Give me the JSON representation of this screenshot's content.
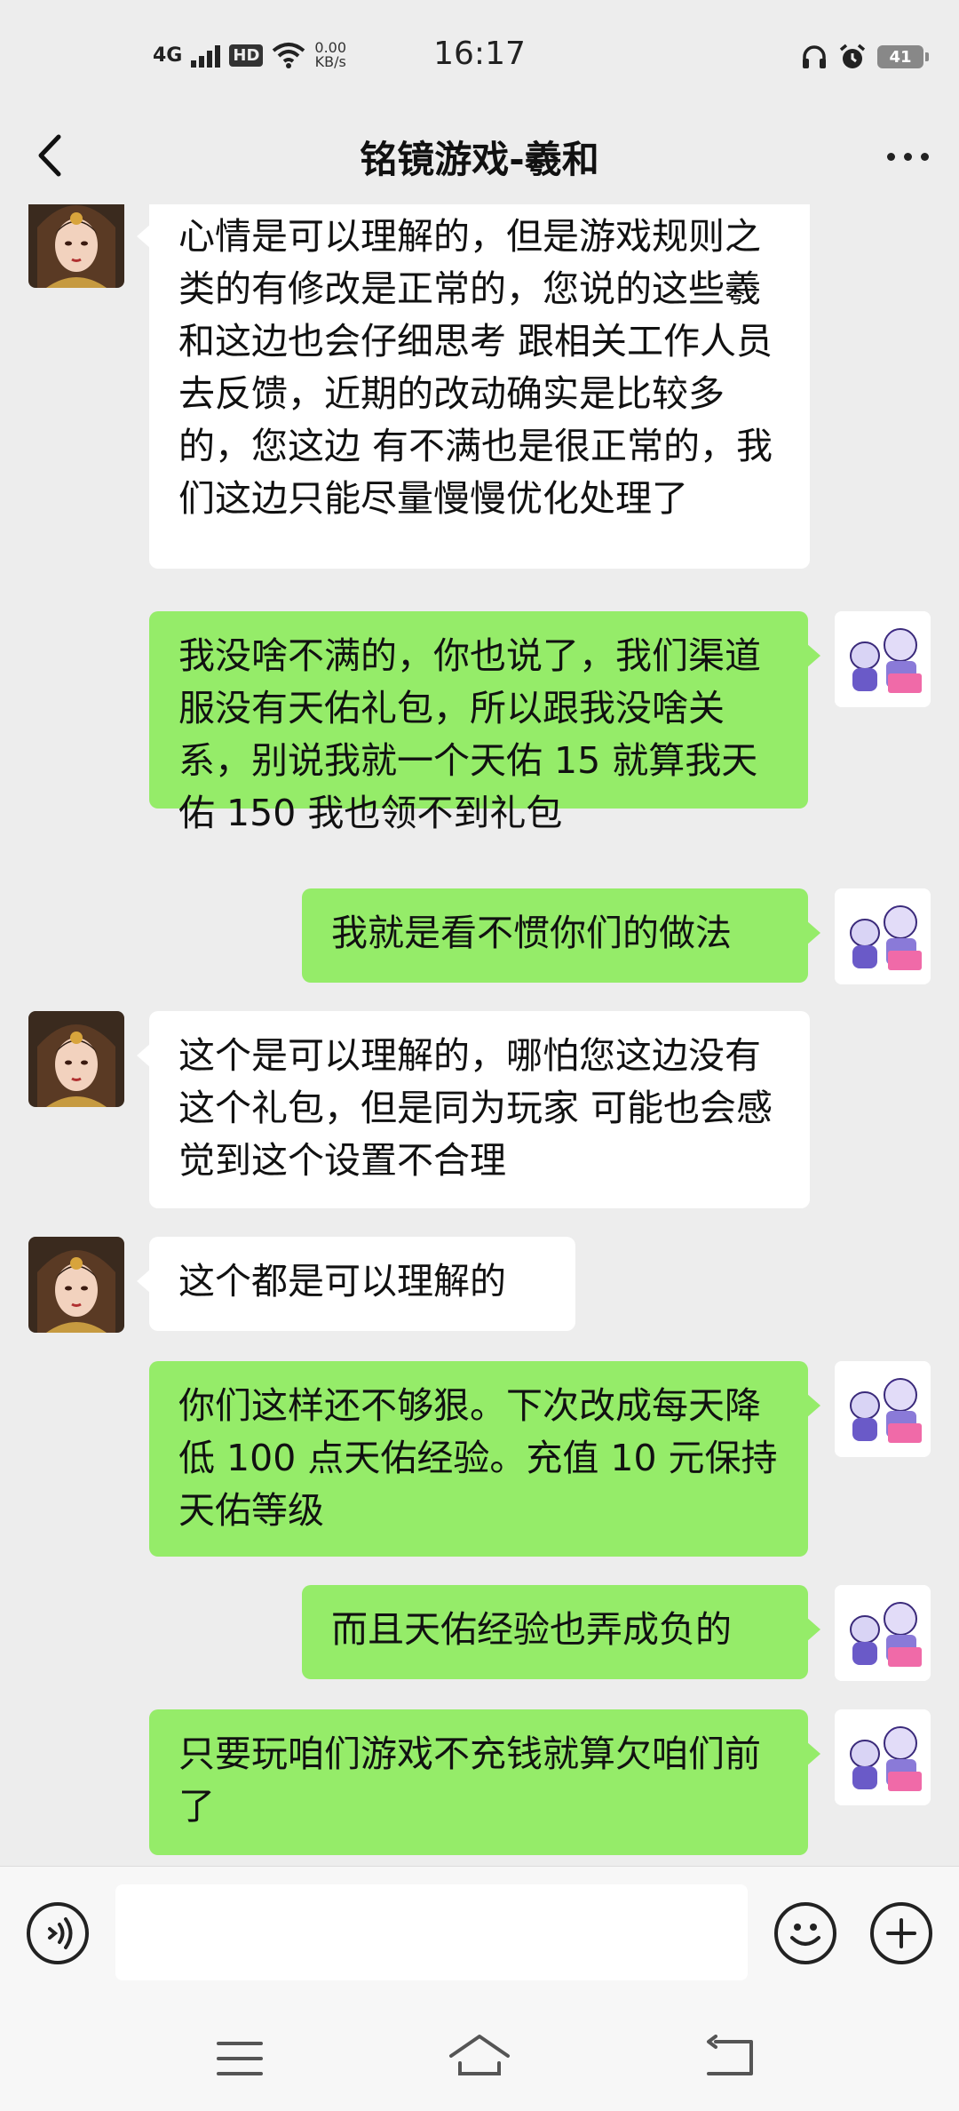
{
  "status_bar": {
    "network": "4G",
    "hd": "HD",
    "speed_value": "0.00",
    "speed_unit": "KB/s",
    "time": "16:17",
    "battery": "41"
  },
  "header": {
    "title": "铭镜游戏-羲和"
  },
  "messages": [
    {
      "side": "in",
      "text": "心情是可以理解的，但是游戏规则之类的有修改是正常的，您说的这些羲和这边也会仔细思考 跟相关工作人员去反馈，近期的改动确实是比较多的，您这边 有不满也是很正常的，我们这边只能尽量慢慢优化处理了"
    },
    {
      "side": "out",
      "text": "我没啥不满的，你也说了，我们渠道服没有天佑礼包，所以跟我没啥关系，别说我就一个天佑 15 就算我天佑 150 我也领不到礼包"
    },
    {
      "side": "out",
      "text": "我就是看不惯你们的做法"
    },
    {
      "side": "in",
      "text": "这个是可以理解的，哪怕您这边没有这个礼包，但是同为玩家 可能也会感觉到这个设置不合理"
    },
    {
      "side": "in",
      "text": "这个都是可以理解的"
    },
    {
      "side": "out",
      "text": "你们这样还不够狠。下次改成每天降低 100 点天佑经验。充值 10 元保持天佑等级"
    },
    {
      "side": "out",
      "text": "而且天佑经验也弄成负的"
    },
    {
      "side": "out",
      "text": "只要玩咱们游戏不充钱就算欠咱们前了"
    }
  ],
  "colors": {
    "background": "#ededed",
    "outgoing_bubble": "#95ec69",
    "incoming_bubble": "#ffffff"
  }
}
